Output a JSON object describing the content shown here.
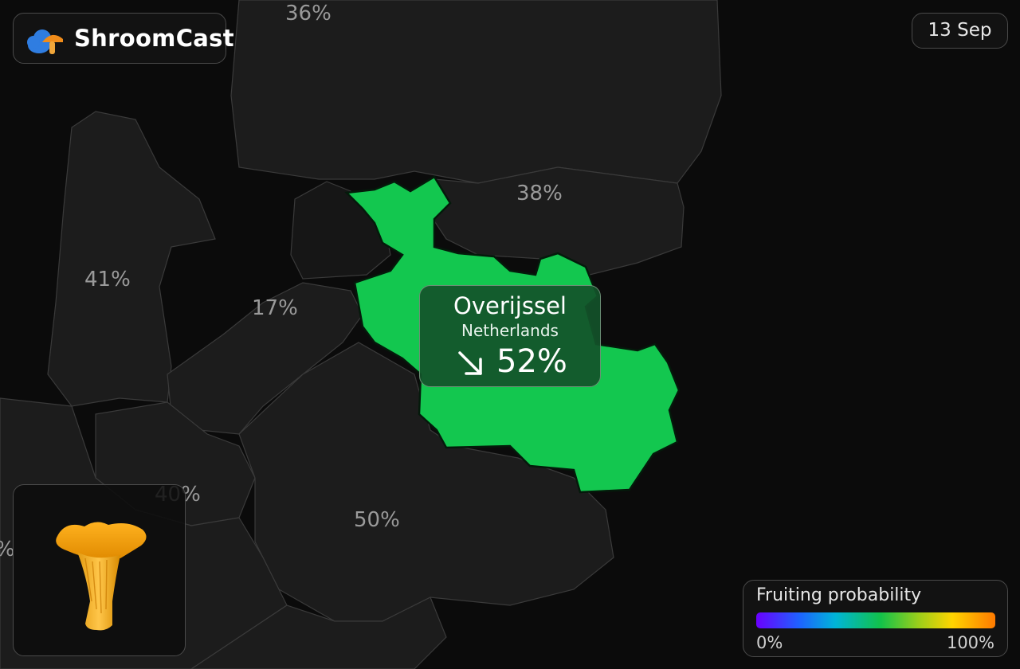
{
  "app": {
    "name": "ShroomCast",
    "logo_icon": "cloud-mushroom-icon"
  },
  "date": "13 Sep",
  "map": {
    "region_labels": [
      {
        "id": "north-top",
        "value": "36%"
      },
      {
        "id": "drenthe",
        "value": "38%"
      },
      {
        "id": "north-holland",
        "value": "41%"
      },
      {
        "id": "flevoland",
        "value": "17%"
      },
      {
        "id": "utrecht",
        "value": "40%"
      },
      {
        "id": "gelderland",
        "value": "50%"
      },
      {
        "id": "south-west",
        "value": "%"
      }
    ],
    "highlight_color": "#13c74f"
  },
  "tooltip": {
    "region": "Overijssel",
    "country": "Netherlands",
    "trend_icon": "arrow-down-right-icon",
    "value": "52%"
  },
  "species": {
    "icon": "chanterelle-mushroom-icon"
  },
  "legend": {
    "title": "Fruiting probability",
    "min_label": "0%",
    "max_label": "100%",
    "colors": [
      "#6a00ff",
      "#1e62ff",
      "#00b4d8",
      "#12c24a",
      "#9ccf1a",
      "#ffd400",
      "#ff7a00"
    ]
  }
}
